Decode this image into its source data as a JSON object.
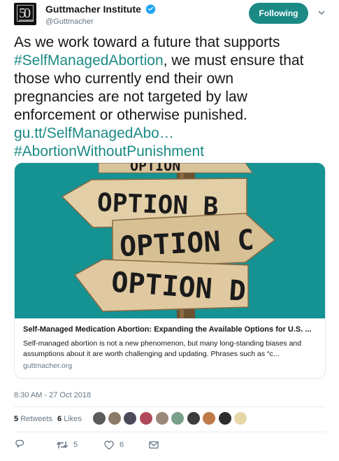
{
  "author": {
    "display_name": "Guttmacher Institute",
    "handle": "@Guttmacher",
    "avatar_text": "50",
    "verified_icon": "verified-badge-icon"
  },
  "follow_button": {
    "label": "Following",
    "color": "#1b8a85"
  },
  "tweet": {
    "line1": "As we work toward a future that supports",
    "hashtag1": "#SelfManagedAbortion",
    "line2_rest": ", we must ensure that",
    "line3": "those who currently end their own",
    "line4": "pregnancies are not targeted by law",
    "line5": "enforcement or otherwise punished.",
    "link": "gu.tt/SelfManagedAbo…",
    "hashtag2": "#AbortionWithoutPunishment"
  },
  "card": {
    "image_signs": [
      "OPTION B",
      "OPTION C",
      "OPTION D"
    ],
    "title": "Self-Managed Medication Abortion: Expanding the Available Options for U.S. ...",
    "description": "Self-managed abortion is not a new phenomenon, but many long-standing biases and assumptions about it are worth challenging and updating. Phrases such as “c...",
    "domain": "guttmacher.org"
  },
  "timestamp": "8:30 AM - 27 Oct 2018",
  "stats": {
    "retweets_count": "5",
    "retweets_label": "Retweets",
    "likes_count": "6",
    "likes_label": "Likes"
  },
  "actions": {
    "reply_icon": "reply-icon",
    "retweet_icon": "retweet-icon",
    "retweet_count": "5",
    "like_icon": "heart-icon",
    "like_count": "6",
    "dm_icon": "envelope-icon"
  },
  "colors": {
    "accent": "#1b8a85",
    "secondary_text": "#657786",
    "card_image_bg": "#159292"
  }
}
